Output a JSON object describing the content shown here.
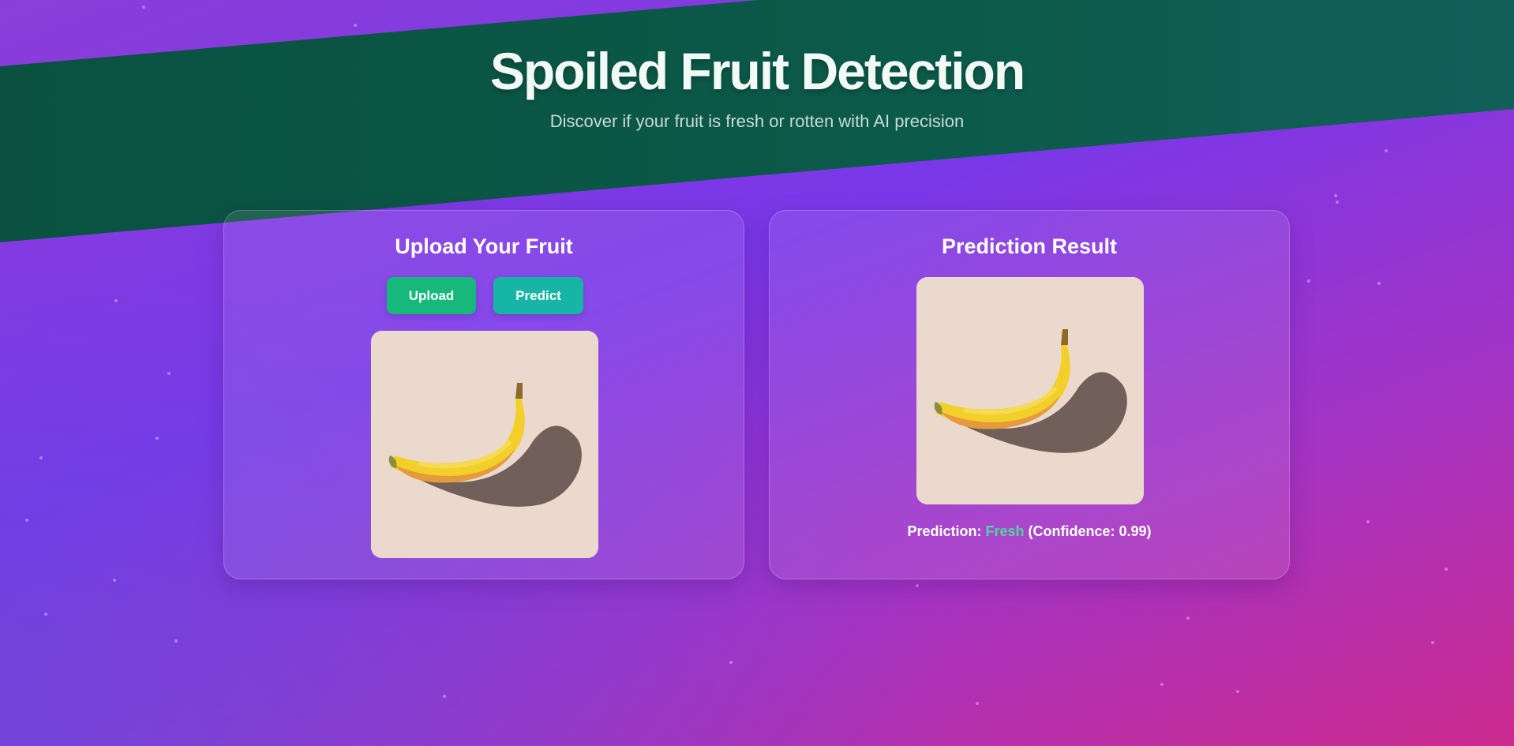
{
  "header": {
    "title": "Spoiled Fruit Detection",
    "subtitle": "Discover if your fruit is fresh or rotten with AI precision"
  },
  "upload_card": {
    "title": "Upload Your Fruit",
    "upload_label": "Upload",
    "predict_label": "Predict",
    "image_icon": "banana-image"
  },
  "result_card": {
    "title": "Prediction Result",
    "image_icon": "banana-image",
    "prediction_prefix": "Prediction: ",
    "prediction_value": "Fresh",
    "confidence_text": " (Confidence: 0.99)"
  },
  "colors": {
    "band": "#0b5a48",
    "upload_button": "#17b87c",
    "predict_button": "#17b5a5",
    "fresh_text": "#4ed99b"
  }
}
